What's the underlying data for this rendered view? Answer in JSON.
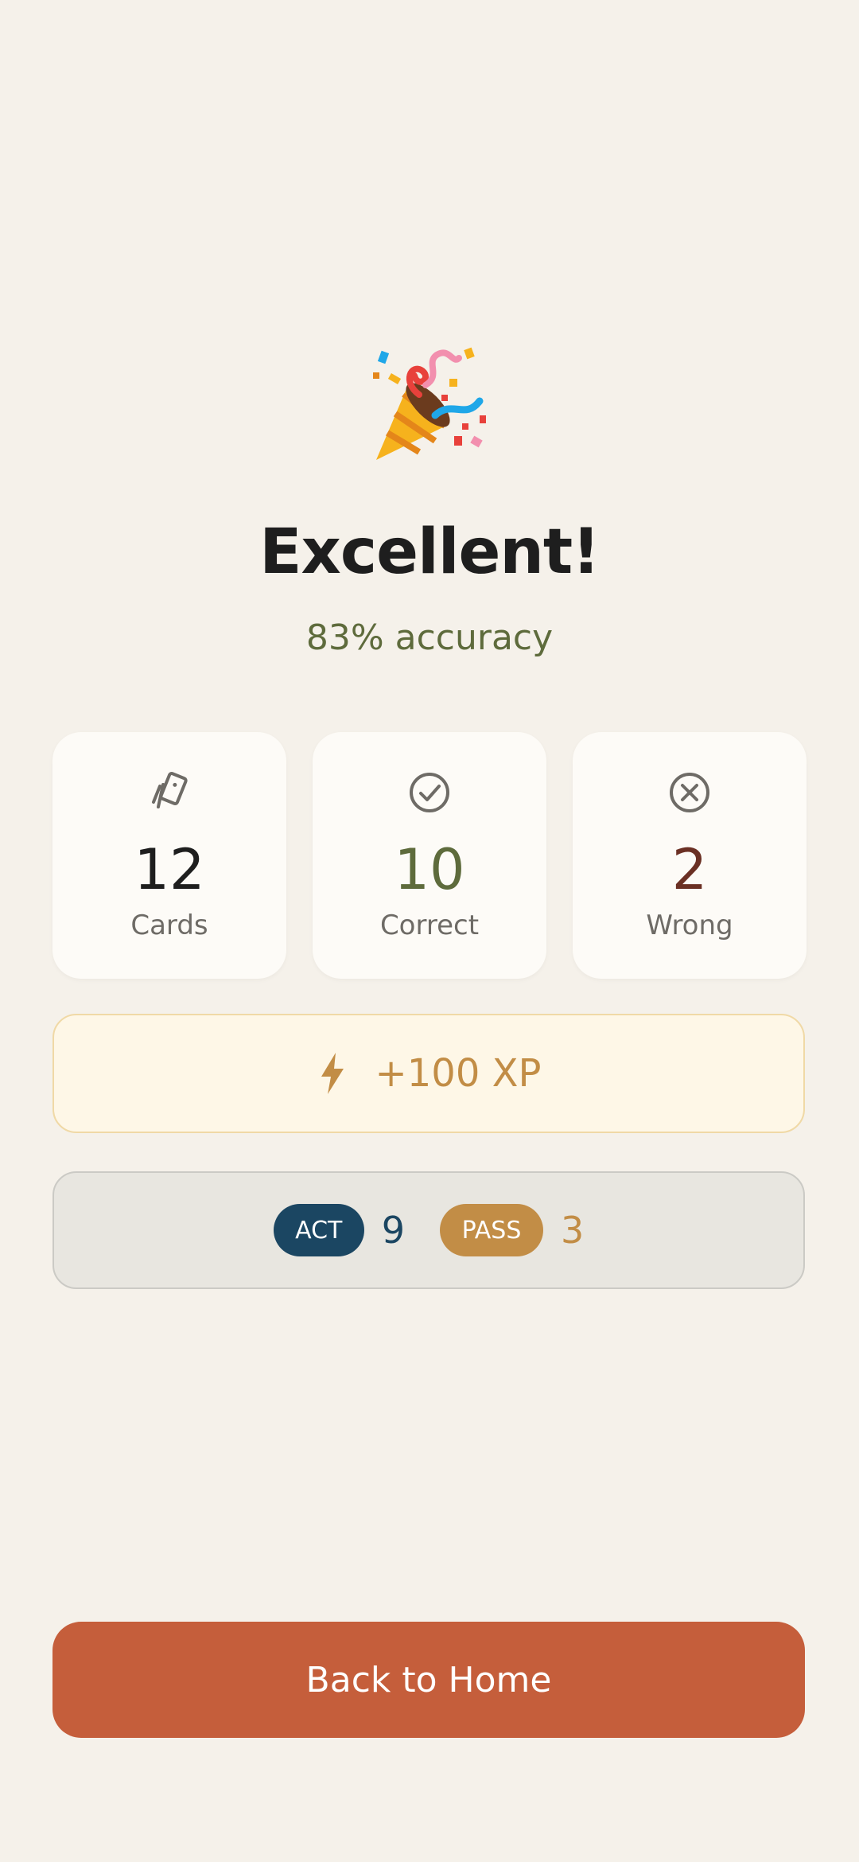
{
  "result": {
    "emoji_icon": "party-popper-icon",
    "title": "Excellent!",
    "accuracy": "83% accuracy"
  },
  "stats": {
    "cards": {
      "value": "12",
      "label": "Cards",
      "icon": "cards-icon",
      "color": "#1e1e1e"
    },
    "correct": {
      "value": "10",
      "label": "Correct",
      "icon": "check-circle-icon",
      "color": "#5e6b3c"
    },
    "wrong": {
      "value": "2",
      "label": "Wrong",
      "icon": "x-circle-icon",
      "color": "#6b3024"
    }
  },
  "xp": {
    "icon": "lightning-icon",
    "text": "+100 XP"
  },
  "status": {
    "act": {
      "label": "ACT",
      "count": "9"
    },
    "pass": {
      "label": "PASS",
      "count": "3"
    }
  },
  "actions": {
    "home_label": "Back to Home"
  },
  "colors": {
    "background": "#f5f1ea",
    "accent": "#c55e3b",
    "xp": "#c28d46",
    "act": "#1b4662",
    "success": "#5e6b3c"
  }
}
